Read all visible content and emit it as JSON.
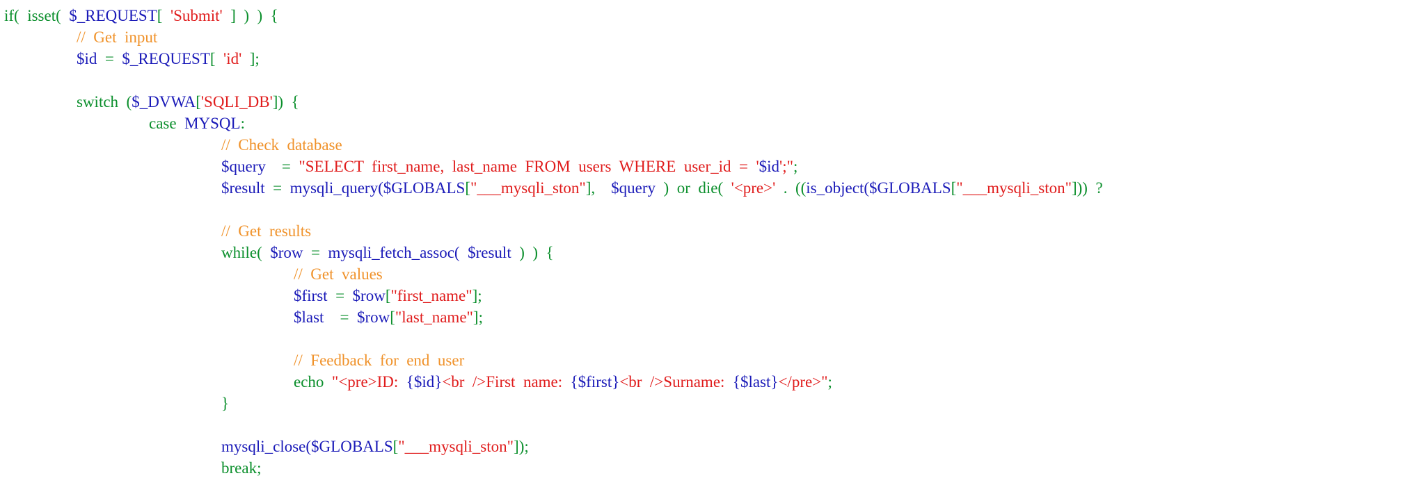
{
  "colors": {
    "background": "#ffffff",
    "kw": "#0b8f2c",
    "var": "#1a1ab8",
    "str": "#e01c1c",
    "cmt": "#f0922a"
  },
  "lines": [
    {
      "indent": 0,
      "tokens": [
        {
          "t": "kw",
          "v": "if(  isset(  "
        },
        {
          "t": "var",
          "v": "$_REQUEST"
        },
        {
          "t": "kw",
          "v": "[  "
        },
        {
          "t": "str",
          "v": "'Submit'"
        },
        {
          "t": "kw",
          "v": "  ]  )  )  {"
        }
      ]
    },
    {
      "indent": 1,
      "tokens": [
        {
          "t": "cmt",
          "v": "//  Get  input"
        }
      ]
    },
    {
      "indent": 1,
      "tokens": [
        {
          "t": "var",
          "v": "$id"
        },
        {
          "t": "kw",
          "v": "  =  "
        },
        {
          "t": "var",
          "v": "$_REQUEST"
        },
        {
          "t": "kw",
          "v": "[  "
        },
        {
          "t": "str",
          "v": "'id'"
        },
        {
          "t": "kw",
          "v": "  ];"
        }
      ]
    },
    {
      "indent": 0,
      "tokens": []
    },
    {
      "indent": 1,
      "tokens": [
        {
          "t": "kw",
          "v": "switch  ("
        },
        {
          "t": "var",
          "v": "$_DVWA"
        },
        {
          "t": "kw",
          "v": "["
        },
        {
          "t": "str",
          "v": "'SQLI_DB'"
        },
        {
          "t": "kw",
          "v": "])  {"
        }
      ]
    },
    {
      "indent": 2,
      "tokens": [
        {
          "t": "kw",
          "v": "case  "
        },
        {
          "t": "var",
          "v": "MYSQL"
        },
        {
          "t": "kw",
          "v": ":"
        }
      ]
    },
    {
      "indent": 3,
      "tokens": [
        {
          "t": "cmt",
          "v": "//  Check  database"
        }
      ]
    },
    {
      "indent": 3,
      "tokens": [
        {
          "t": "var",
          "v": "$query"
        },
        {
          "t": "kw",
          "v": "    =  "
        },
        {
          "t": "str",
          "v": "\"SELECT  first_name,  last_name  FROM  users  WHERE  user_id  =  '"
        },
        {
          "t": "var",
          "v": "$id"
        },
        {
          "t": "str",
          "v": "';\""
        },
        {
          "t": "kw",
          "v": ";"
        }
      ]
    },
    {
      "indent": 3,
      "tokens": [
        {
          "t": "var",
          "v": "$result"
        },
        {
          "t": "kw",
          "v": "  =  "
        },
        {
          "t": "var",
          "v": "mysqli_query("
        },
        {
          "t": "var",
          "v": "$GLOBALS"
        },
        {
          "t": "kw",
          "v": "["
        },
        {
          "t": "str",
          "v": "\"___mysqli_ston\""
        },
        {
          "t": "kw",
          "v": "],    "
        },
        {
          "t": "var",
          "v": "$query"
        },
        {
          "t": "kw",
          "v": "  )  or  die(  "
        },
        {
          "t": "str",
          "v": "'<pre>'"
        },
        {
          "t": "kw",
          "v": "  .  (("
        },
        {
          "t": "var",
          "v": "is_object("
        },
        {
          "t": "var",
          "v": "$GLOBALS"
        },
        {
          "t": "kw",
          "v": "["
        },
        {
          "t": "str",
          "v": "\"___mysqli_ston\""
        },
        {
          "t": "kw",
          "v": "]))  ?"
        }
      ]
    },
    {
      "indent": 0,
      "tokens": []
    },
    {
      "indent": 3,
      "tokens": [
        {
          "t": "cmt",
          "v": "//  Get  results"
        }
      ]
    },
    {
      "indent": 3,
      "tokens": [
        {
          "t": "kw",
          "v": "while(  "
        },
        {
          "t": "var",
          "v": "$row"
        },
        {
          "t": "kw",
          "v": "  =  "
        },
        {
          "t": "var",
          "v": "mysqli_fetch_assoc("
        },
        {
          "t": "kw",
          "v": "  "
        },
        {
          "t": "var",
          "v": "$result"
        },
        {
          "t": "kw",
          "v": "  )  )  {"
        }
      ]
    },
    {
      "indent": 4,
      "tokens": [
        {
          "t": "cmt",
          "v": "//  Get  values"
        }
      ]
    },
    {
      "indent": 4,
      "tokens": [
        {
          "t": "var",
          "v": "$first"
        },
        {
          "t": "kw",
          "v": "  =  "
        },
        {
          "t": "var",
          "v": "$row"
        },
        {
          "t": "kw",
          "v": "["
        },
        {
          "t": "str",
          "v": "\"first_name\""
        },
        {
          "t": "kw",
          "v": "];"
        }
      ]
    },
    {
      "indent": 4,
      "tokens": [
        {
          "t": "var",
          "v": "$last"
        },
        {
          "t": "kw",
          "v": "    =  "
        },
        {
          "t": "var",
          "v": "$row"
        },
        {
          "t": "kw",
          "v": "["
        },
        {
          "t": "str",
          "v": "\"last_name\""
        },
        {
          "t": "kw",
          "v": "];"
        }
      ]
    },
    {
      "indent": 0,
      "tokens": []
    },
    {
      "indent": 4,
      "tokens": [
        {
          "t": "cmt",
          "v": "//  Feedback  for  end  user"
        }
      ]
    },
    {
      "indent": 4,
      "tokens": [
        {
          "t": "kw",
          "v": "echo  "
        },
        {
          "t": "str",
          "v": "\"<pre>ID:  "
        },
        {
          "t": "var",
          "v": "{$id}"
        },
        {
          "t": "str",
          "v": "<br  />First  name:  "
        },
        {
          "t": "var",
          "v": "{$first}"
        },
        {
          "t": "str",
          "v": "<br  />Surname:  "
        },
        {
          "t": "var",
          "v": "{$last}"
        },
        {
          "t": "str",
          "v": "</pre>\""
        },
        {
          "t": "kw",
          "v": ";"
        }
      ]
    },
    {
      "indent": 3,
      "tokens": [
        {
          "t": "kw",
          "v": "}"
        }
      ]
    },
    {
      "indent": 0,
      "tokens": []
    },
    {
      "indent": 3,
      "tokens": [
        {
          "t": "var",
          "v": "mysqli_close("
        },
        {
          "t": "var",
          "v": "$GLOBALS"
        },
        {
          "t": "kw",
          "v": "["
        },
        {
          "t": "str",
          "v": "\"___mysqli_ston\""
        },
        {
          "t": "kw",
          "v": "]);"
        }
      ]
    },
    {
      "indent": 3,
      "tokens": [
        {
          "t": "kw",
          "v": "break;"
        }
      ]
    }
  ]
}
